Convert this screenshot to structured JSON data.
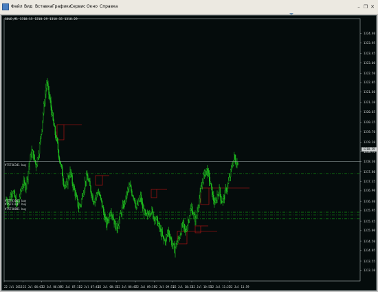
{
  "menu": {
    "items": [
      "Файл",
      "Вид",
      "Вставка",
      "Графики",
      "Сервис",
      "Окно",
      "Справка"
    ]
  },
  "window_controls": {
    "minimize_glyph": "–",
    "restore_glyph": "❐",
    "close_glyph": "✕"
  },
  "chart": {
    "symbol_info": "GOLD,M1  1318.15 1318.29 1318.15 1318.29",
    "current_price_label": "1318.29",
    "price_line_color": "#a9b5b5",
    "candle_color": "#1fbf1f",
    "order_line_color": "#12a012",
    "box_color": "#c81414"
  },
  "order_labels": [
    "#75736341 buy",
    "#75731041 buy",
    "#75731147 buy",
    "#75730881 buy"
  ],
  "chart_data": {
    "type": "candlestick",
    "title": "GOLD,M1",
    "ylim": [
      1312.6,
      1325.1
    ],
    "y_ticks": [
      "1324.40",
      "1323.95",
      "1323.45",
      "1323.00",
      "1322.50",
      "1322.05",
      "1321.60",
      "1321.10",
      "1320.65",
      "1320.15",
      "1319.70",
      "1319.20",
      "1318.75",
      "1318.30",
      "1317.80",
      "1317.35",
      "1316.90",
      "1316.40",
      "1315.95",
      "1315.45",
      "1315.00",
      "1314.50",
      "1314.05",
      "1313.55",
      "1313.10"
    ],
    "x_ticks": [
      "22 Jul 2013",
      "22 Jul 06:07",
      "22 Jul 06:39",
      "22 Jul 07:11",
      "22 Jul 07:43",
      "22 Jul 08:15",
      "22 Jul 08:47",
      "22 Jul 09:19",
      "22 Jul 09:51",
      "22 Jul 10:23",
      "22 Jul 10:55",
      "22 Jul 11:27",
      "22 Jul 11:59"
    ],
    "current_price": 1318.29,
    "order_levels": [
      1317.72,
      1315.88,
      1315.75,
      1315.56
    ],
    "price_path": [
      1316.5,
      1316.3,
      1316.7,
      1316.9,
      1316.6,
      1316.2,
      1316.5,
      1316.9,
      1317.3,
      1317.1,
      1317.6,
      1318.3,
      1318.8,
      1318.5,
      1318.1,
      1318.6,
      1319.3,
      1320.3,
      1321.2,
      1322.1,
      1321.5,
      1320.9,
      1320.2,
      1319.6,
      1319.1,
      1318.4,
      1317.9,
      1317.3,
      1317.0,
      1317.5,
      1317.8,
      1317.3,
      1316.9,
      1316.5,
      1316.1,
      1316.3,
      1316.8,
      1317.3,
      1317.6,
      1317.2,
      1316.8,
      1316.4,
      1316.6,
      1316.9,
      1316.6,
      1316.2,
      1315.7,
      1315.3,
      1315.6,
      1316.0,
      1315.7,
      1315.3,
      1315.1,
      1315.5,
      1315.9,
      1316.2,
      1316.5,
      1316.9,
      1317.1,
      1316.8,
      1316.6,
      1316.1,
      1316.3,
      1316.6,
      1316.1,
      1315.8,
      1315.6,
      1315.9,
      1316.0,
      1315.7,
      1315.6,
      1315.4,
      1315.1,
      1314.8,
      1314.5,
      1314.6,
      1315.0,
      1314.7,
      1314.3,
      1314.1,
      1314.4,
      1314.6,
      1315.0,
      1315.3,
      1314.9,
      1315.3,
      1315.8,
      1316.1,
      1315.7,
      1315.5,
      1316.2,
      1316.7,
      1317.3,
      1317.7,
      1317.9,
      1317.6,
      1317.1,
      1316.6,
      1316.2,
      1316.7,
      1316.9,
      1316.4,
      1316.5,
      1316.9,
      1317.2,
      1317.6,
      1318.1,
      1318.5,
      1318.2,
      1318.3
    ]
  },
  "colors": {
    "background": "#050c0c",
    "menubar": "#ece9e1",
    "axis_text": "#d8dcdc",
    "frame": "#a9b5b5"
  }
}
